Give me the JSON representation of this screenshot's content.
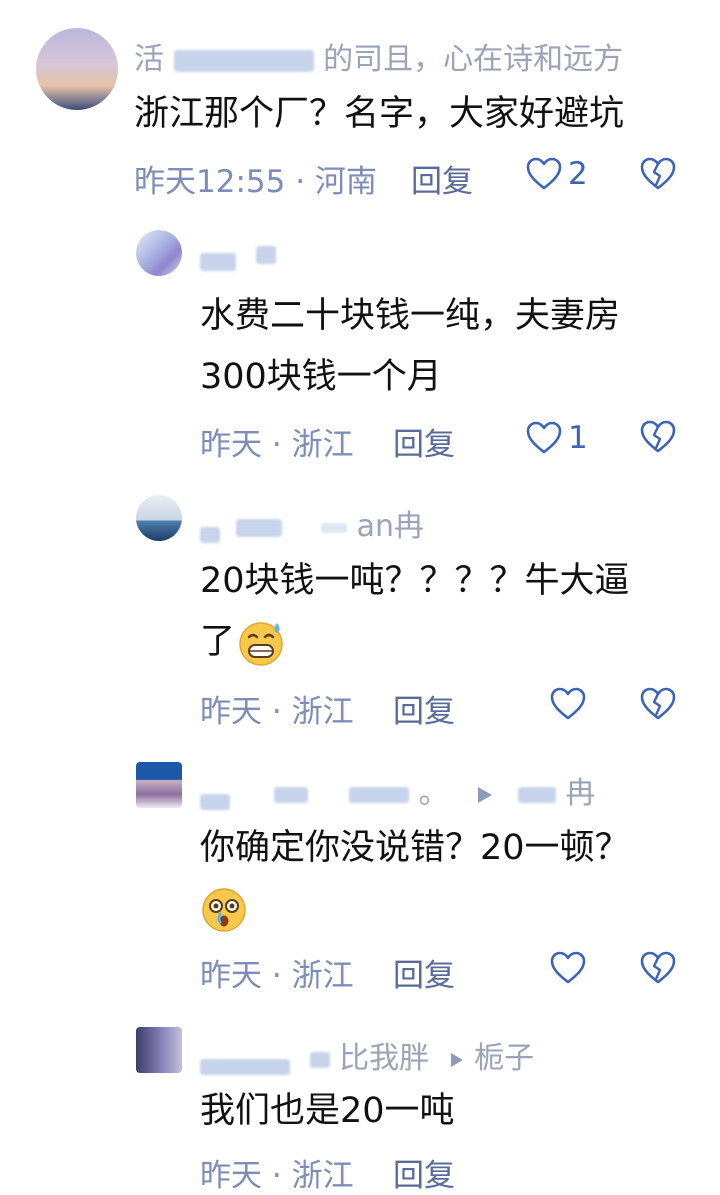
{
  "comments": [
    {
      "name_visible_start": "活",
      "name_visible_end": "的司且，心在诗和远方",
      "text_lines": [
        "浙江那个厂？名字，大家好避坑"
      ],
      "time": "昨天12:55",
      "location": "河南",
      "reply_label": "回复",
      "likes": "2"
    },
    {
      "name_visible_end": "",
      "text_lines": [
        "水费二十块钱一纯，夫妻房",
        "300块钱一个月"
      ],
      "time": "昨天",
      "location": "浙江",
      "reply_label": "回复",
      "likes": "1"
    },
    {
      "name_visible_end": "an冉",
      "text_lines": [
        "20块钱一吨？？？？牛大逼",
        "了"
      ],
      "time": "昨天",
      "location": "浙江",
      "reply_label": "回复",
      "likes": ""
    },
    {
      "name_visible_mid": "。",
      "name_visible_end": "冉",
      "text_lines": [
        "你确定你没说错？20一顿？"
      ],
      "time": "昨天",
      "location": "浙江",
      "reply_label": "回复",
      "likes": ""
    },
    {
      "name_visible_end": "比我胖",
      "reply_to": "栀子",
      "text_lines": [
        "我们也是20一吨"
      ],
      "time": "昨天",
      "location": "浙江",
      "reply_label": "回复"
    }
  ],
  "separator": "·",
  "icons": {
    "like": "heart-outline-icon",
    "dislike": "broken-heart-icon",
    "reply_arrow": "reply-arrow-icon",
    "emoji_grin_sweat": "grinning-sweat-emoji",
    "emoji_shocked": "shocked-face-emoji"
  },
  "colors": {
    "accent": "#3b63b8",
    "meta": "#7b8db8",
    "name": "#9aa3b8"
  }
}
